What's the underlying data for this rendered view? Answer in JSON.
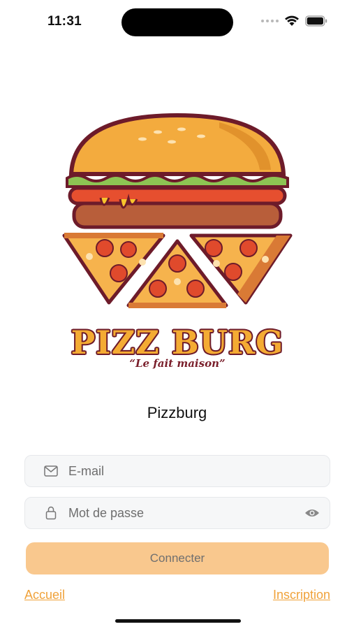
{
  "status_bar": {
    "time": "11:31"
  },
  "logo": {
    "brand_name": "PIZZ BURG",
    "slogan": "“Le fait maison”"
  },
  "app_title": "Pizzburg",
  "form": {
    "email_placeholder": "E-mail",
    "password_placeholder": "Mot de passe",
    "submit_label": "Connecter"
  },
  "links": {
    "home": "Accueil",
    "signup": "Inscription"
  },
  "colors": {
    "accent": "#f0a23a",
    "button_bg": "#f9c88e",
    "field_bg": "#f6f7f8",
    "logo_outline": "#6d1b2a"
  }
}
